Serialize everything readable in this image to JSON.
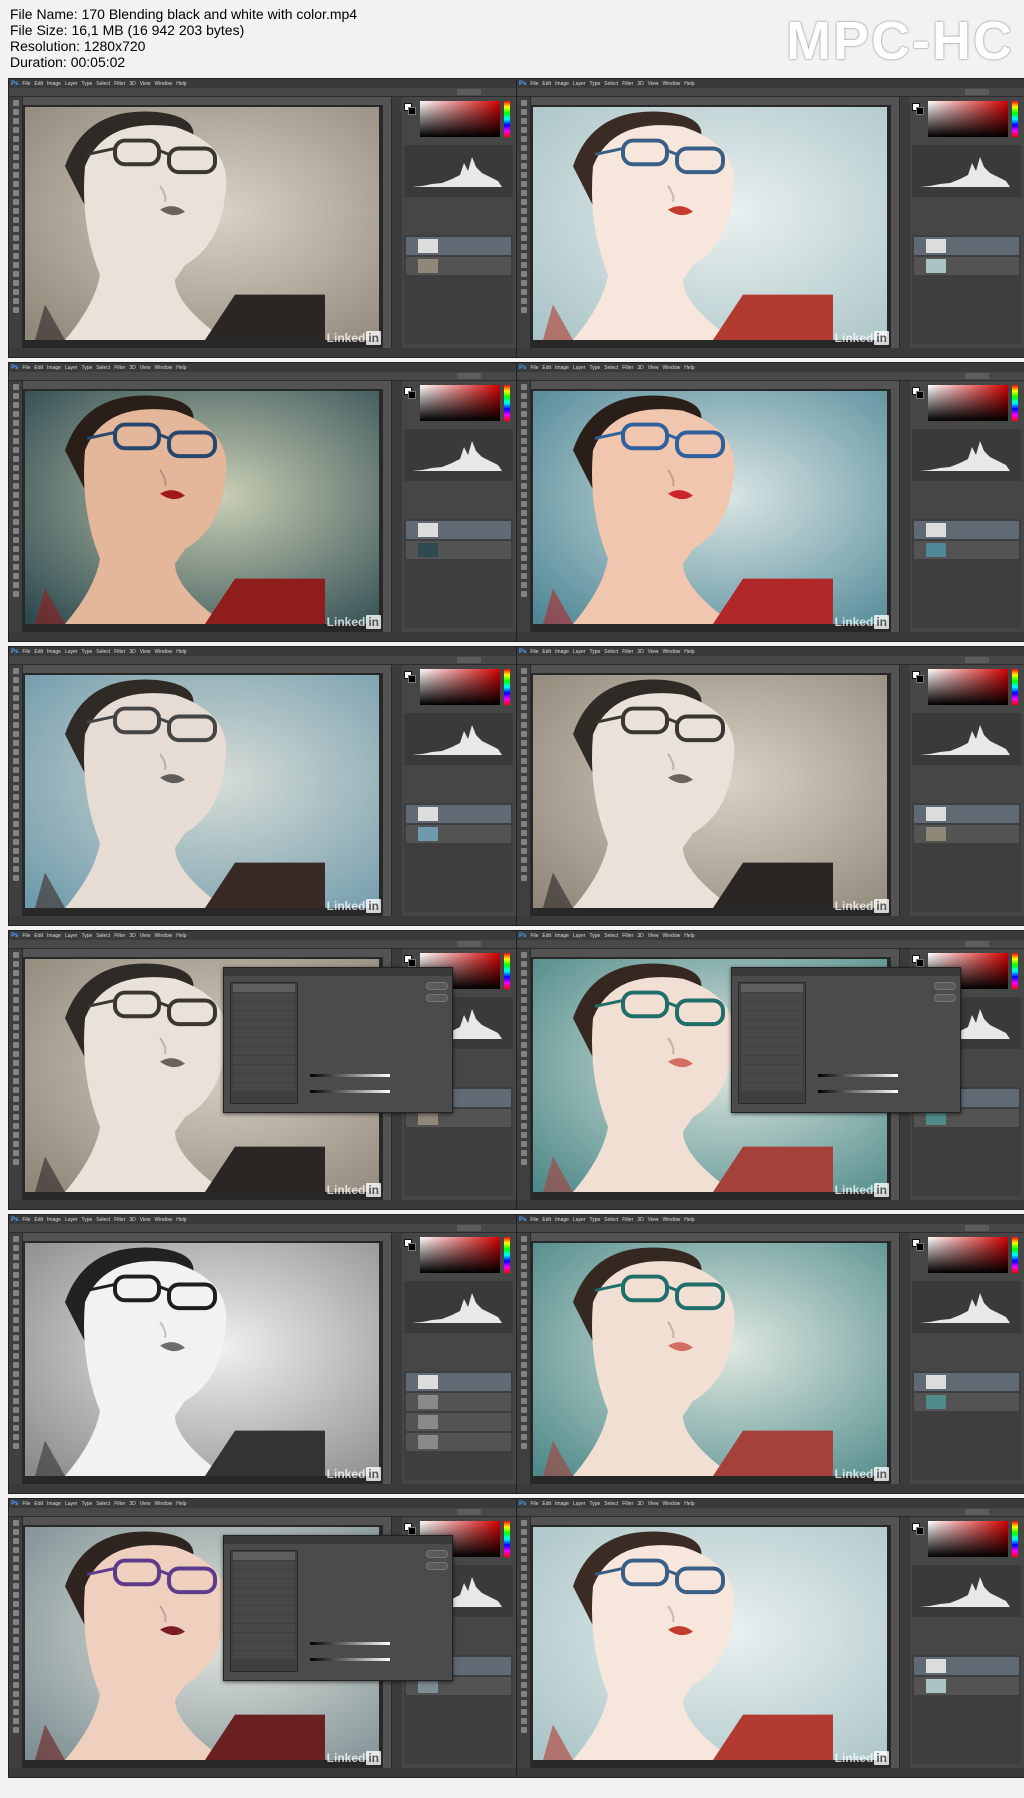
{
  "info": {
    "file_name": "File Name: 170 Blending black and white with color.mp4",
    "file_size": "File Size: 16,1 MB (16 942 203 bytes)",
    "resolution": "Resolution: 1280x720",
    "duration": "Duration: 00:05:02"
  },
  "player_logo": "MPC-HC",
  "watermark": {
    "text": "Linked",
    "badge": "in"
  },
  "app": {
    "logo": "Ps",
    "menus": [
      "File",
      "Edit",
      "Image",
      "Layer",
      "Type",
      "Select",
      "Filter",
      "3D",
      "View",
      "Window",
      "Help"
    ]
  },
  "frames": [
    {
      "tone": "sepia",
      "dialog": false,
      "panel": "histogram"
    },
    {
      "tone": "color-bright",
      "dialog": false,
      "panel": "histogram"
    },
    {
      "tone": "color-dark",
      "dialog": false,
      "panel": "histogram"
    },
    {
      "tone": "color",
      "dialog": false,
      "panel": "histogram"
    },
    {
      "tone": "color-muted",
      "dialog": false,
      "panel": "histogram"
    },
    {
      "tone": "sepia",
      "dialog": false,
      "panel": "histogram"
    },
    {
      "tone": "sepia",
      "dialog": true,
      "panel": "layer-style"
    },
    {
      "tone": "teal",
      "dialog": true,
      "panel": "layer-style"
    },
    {
      "tone": "bw",
      "dialog": false,
      "panel": "channels"
    },
    {
      "tone": "teal",
      "dialog": false,
      "panel": "histogram"
    },
    {
      "tone": "purple",
      "dialog": true,
      "panel": "layer-style"
    },
    {
      "tone": "color-bright",
      "dialog": false,
      "panel": "histogram"
    }
  ],
  "colors": {
    "sepia": {
      "bg1": "#d8d2c6",
      "bg2": "#8f8778",
      "skin": "#e8e2d8",
      "lips": "#6a625c",
      "frame": "#3a3632",
      "hair": "#2e2a26",
      "top": "#2a2624"
    },
    "color-bright": {
      "bg1": "#e9f0f0",
      "bg2": "#aac4c6",
      "skin": "#f6e6dc",
      "lips": "#c43a2c",
      "frame": "#3a5f86",
      "hair": "#3a2c24",
      "top": "#b23a30"
    },
    "color-dark": {
      "bg1": "#c9cfb4",
      "bg2": "#2d4a50",
      "skin": "#e4b69a",
      "lips": "#a1181c",
      "frame": "#27476e",
      "hair": "#2a1e18",
      "top": "#8f1d1c"
    },
    "color": {
      "bg1": "#d9e5e4",
      "bg2": "#4f8796",
      "skin": "#f0c6ae",
      "lips": "#d0222a",
      "frame": "#2f5f9c",
      "hair": "#2a1e18",
      "top": "#b0282a"
    },
    "color-muted": {
      "bg1": "#d6dcd6",
      "bg2": "#6f9aab",
      "skin": "#e6dcd4",
      "lips": "#5e5a58",
      "frame": "#454545",
      "hair": "#302a26",
      "top": "#3a2a26"
    },
    "teal": {
      "bg1": "#dfe8e0",
      "bg2": "#4f8a8a",
      "skin": "#f1dfd3",
      "lips": "#d36e60",
      "frame": "#1f6e6a",
      "hair": "#352820",
      "top": "#a6403a"
    },
    "bw": {
      "bg1": "#f0f0f0",
      "bg2": "#8a8a8a",
      "skin": "#f2f2f2",
      "lips": "#6c6c6c",
      "frame": "#1f1f1f",
      "hair": "#222222",
      "top": "#333333"
    },
    "purple": {
      "bg1": "#e5e8e0",
      "bg2": "#7d8f93",
      "skin": "#efcfbe",
      "lips": "#7a1e24",
      "frame": "#5d3a8a",
      "hair": "#2f2420",
      "top": "#6a2020"
    }
  }
}
